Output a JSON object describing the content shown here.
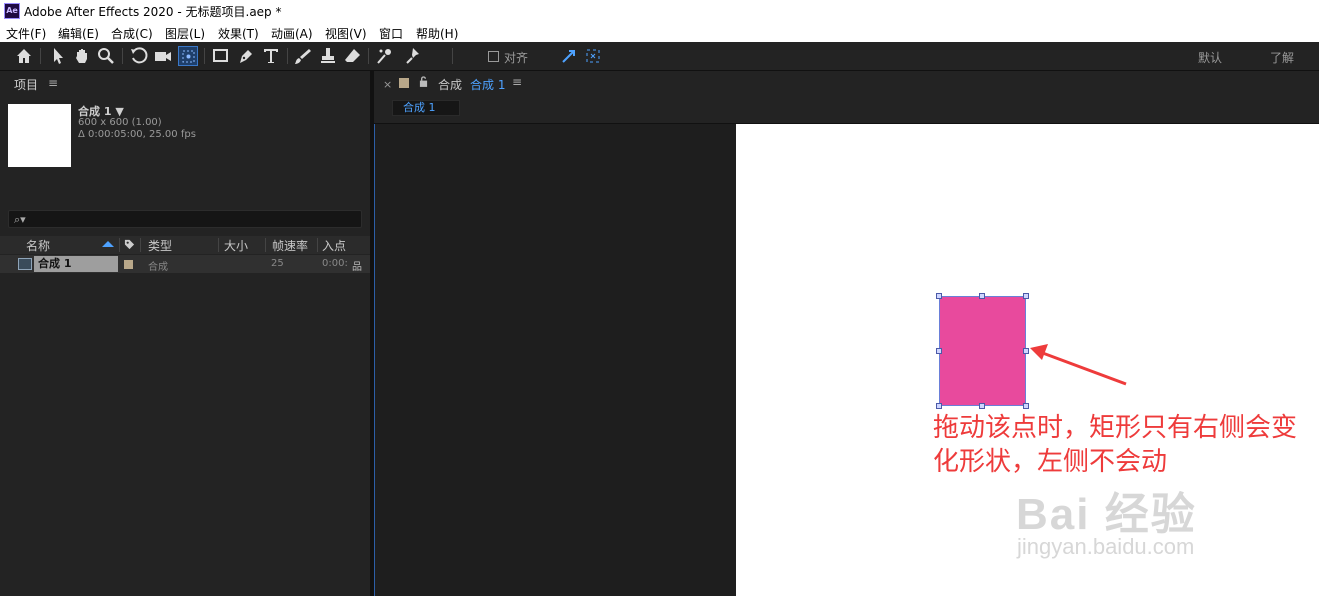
{
  "window": {
    "app_icon_text": "Ae",
    "title": "Adobe After Effects 2020 - 无标题项目.aep *"
  },
  "menu": [
    "文件(F)",
    "编辑(E)",
    "合成(C)",
    "图层(L)",
    "效果(T)",
    "动画(A)",
    "视图(V)",
    "窗口",
    "帮助(H)"
  ],
  "toolbar": {
    "tools": [
      "home-icon",
      "selection-icon",
      "hand-icon",
      "zoom-icon",
      "rotate-icon",
      "camera-icon",
      "pan-behind-icon",
      "rectangle-icon",
      "pen-icon",
      "type-icon",
      "brush-icon",
      "clone-stamp-icon",
      "eraser-icon",
      "roto-brush-icon",
      "puppet-pin-icon"
    ],
    "snap_label": "对齐",
    "workspace_default": "默认",
    "workspace_learn": "了解"
  },
  "project": {
    "tab_label": "项目",
    "menu_glyph": "≡",
    "comp_name": "合成 1 ▼",
    "comp_size": "600 x 600 (1.00)",
    "comp_duration": "Δ 0:00:05:00, 25.00 fps",
    "search_glyph": "⌕▾",
    "columns": [
      "名称",
      "类型",
      "大小",
      "帧速率",
      "入点"
    ],
    "row": {
      "name": "合成 1",
      "type": "合成",
      "fps": "25",
      "in_point": "0:00:",
      "flow_glyph": "品"
    }
  },
  "composition": {
    "close_glyph": "×",
    "lock_glyph": "🔓",
    "tab_prefix": "合成",
    "tab_name": "合成 1",
    "menu_glyph": "≡",
    "flow_tab": "合成 1"
  },
  "canvas": {
    "shape_color": "#e84a9d",
    "annotation": "拖动该点时，矩形只有右侧会变化形状，左侧不会动",
    "watermark_main": "Bai 经验",
    "watermark_sub": "jingyan.baidu.com"
  }
}
